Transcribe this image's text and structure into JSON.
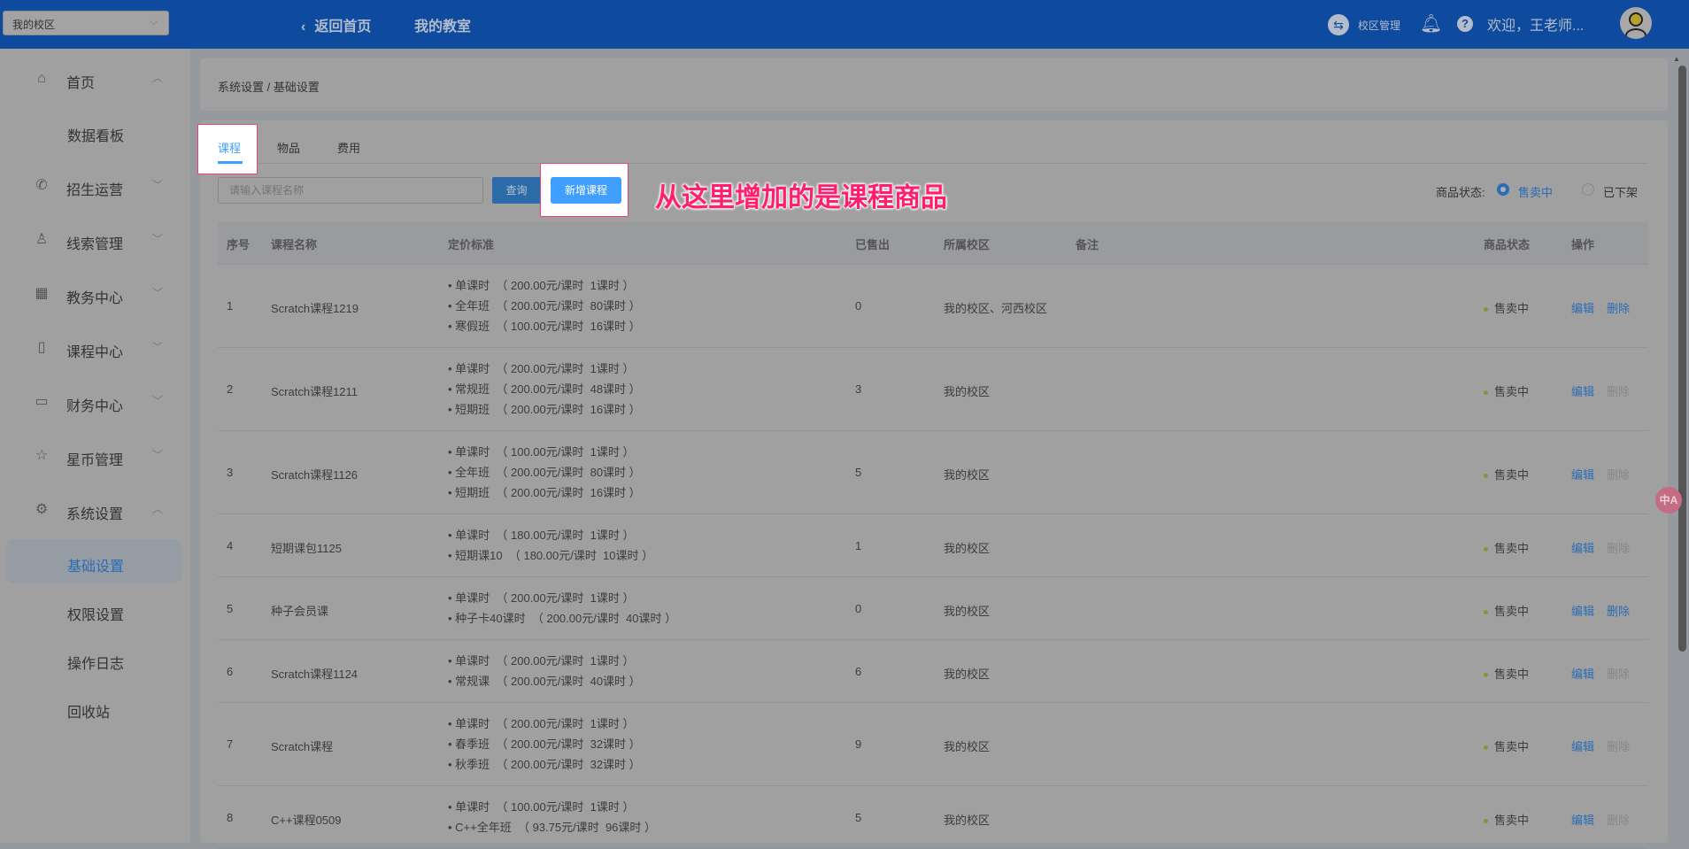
{
  "header": {
    "campus_select": "我的校区",
    "back_home": "返回首页",
    "my_classroom": "我的教室",
    "campus_manage": "校区管理",
    "welcome": "欢迎，王老师..."
  },
  "sidebar": {
    "items": [
      {
        "label": "首页",
        "icon": "home-icon"
      },
      {
        "label": "数据看板",
        "sub": true
      },
      {
        "label": "招生运营",
        "icon": "phone-icon"
      },
      {
        "label": "线索管理",
        "icon": "user-icon"
      },
      {
        "label": "教务中心",
        "icon": "building-icon"
      },
      {
        "label": "课程中心",
        "icon": "notebook-icon"
      },
      {
        "label": "财务中心",
        "icon": "card-icon"
      },
      {
        "label": "星币管理",
        "icon": "star-icon"
      },
      {
        "label": "系统设置",
        "icon": "gear-icon"
      },
      {
        "label": "基础设置",
        "sub": true,
        "active": true
      },
      {
        "label": "权限设置",
        "sub": true
      },
      {
        "label": "操作日志",
        "sub": true
      },
      {
        "label": "回收站",
        "sub": true
      }
    ]
  },
  "breadcrumb": "系统设置 / 基础设置",
  "tabs": [
    "课程",
    "物品",
    "费用"
  ],
  "search": {
    "placeholder": "请输入课程名称",
    "query_label": "查询",
    "add_label": "新增课程"
  },
  "annotation": "从这里增加的是课程商品",
  "status_filter": {
    "label": "商品状态:",
    "options": [
      "售卖中",
      "已下架"
    ],
    "selected": "售卖中"
  },
  "table": {
    "headers": [
      "序号",
      "课程名称",
      "定价标准",
      "已售出",
      "所属校区",
      "备注",
      "商品状态",
      "操作"
    ],
    "rows": [
      {
        "no": "1",
        "name": "Scratch课程1219",
        "prices": [
          "• 单课时  （ 200.00元/课时  1课时 ）",
          "• 全年班  （ 200.00元/课时  80课时 ）",
          "• 寒假班  （ 100.00元/课时  16课时 ）"
        ],
        "sold": "0",
        "campus": "我的校区、河西校区",
        "note": "",
        "status": "售卖中",
        "edit": "编辑",
        "del": "删除",
        "del_enabled": true
      },
      {
        "no": "2",
        "name": "Scratch课程1211",
        "prices": [
          "• 单课时  （ 200.00元/课时  1课时 ）",
          "• 常规班  （ 200.00元/课时  48课时 ）",
          "• 短期班  （ 200.00元/课时  16课时 ）"
        ],
        "sold": "3",
        "campus": "我的校区",
        "note": "",
        "status": "售卖中",
        "edit": "编辑",
        "del": "删除",
        "del_enabled": false
      },
      {
        "no": "3",
        "name": "Scratch课程1126",
        "prices": [
          "• 单课时  （ 100.00元/课时  1课时 ）",
          "• 全年班  （ 200.00元/课时  80课时 ）",
          "• 短期班  （ 200.00元/课时  16课时 ）"
        ],
        "sold": "5",
        "campus": "我的校区",
        "note": "",
        "status": "售卖中",
        "edit": "编辑",
        "del": "删除",
        "del_enabled": false
      },
      {
        "no": "4",
        "name": "短期课包1125",
        "prices": [
          "• 单课时  （ 180.00元/课时  1课时 ）",
          "• 短期课10  （ 180.00元/课时  10课时 ）"
        ],
        "sold": "1",
        "campus": "我的校区",
        "note": "",
        "status": "售卖中",
        "edit": "编辑",
        "del": "删除",
        "del_enabled": false
      },
      {
        "no": "5",
        "name": "种子会员课",
        "prices": [
          "• 单课时  （ 200.00元/课时  1课时 ）",
          "• 种子卡40课时  （ 200.00元/课时  40课时 ）"
        ],
        "sold": "0",
        "campus": "我的校区",
        "note": "",
        "status": "售卖中",
        "edit": "编辑",
        "del": "删除",
        "del_enabled": true
      },
      {
        "no": "6",
        "name": "Scratch课程1124",
        "prices": [
          "• 单课时  （ 200.00元/课时  1课时 ）",
          "• 常规课  （ 200.00元/课时  40课时 ）"
        ],
        "sold": "6",
        "campus": "我的校区",
        "note": "",
        "status": "售卖中",
        "edit": "编辑",
        "del": "删除",
        "del_enabled": false
      },
      {
        "no": "7",
        "name": "Scratch课程",
        "prices": [
          "• 单课时  （ 200.00元/课时  1课时 ）",
          "• 春季班  （ 200.00元/课时  32课时 ）",
          "• 秋季班  （ 200.00元/课时  32课时 ）"
        ],
        "sold": "9",
        "campus": "我的校区",
        "note": "",
        "status": "售卖中",
        "edit": "编辑",
        "del": "删除",
        "del_enabled": false
      },
      {
        "no": "8",
        "name": "C++课程0509",
        "prices": [
          "• 单课时  （ 100.00元/课时  1课时 ）",
          "• C++全年班  （ 93.75元/课时  96课时 ）"
        ],
        "sold": "5",
        "campus": "我的校区",
        "note": "",
        "status": "售卖中",
        "edit": "编辑",
        "del": "删除",
        "del_enabled": false
      }
    ]
  },
  "colors": {
    "header": "#0e4a9e",
    "primary": "#409eff",
    "annotation": "#ff1f6e"
  }
}
